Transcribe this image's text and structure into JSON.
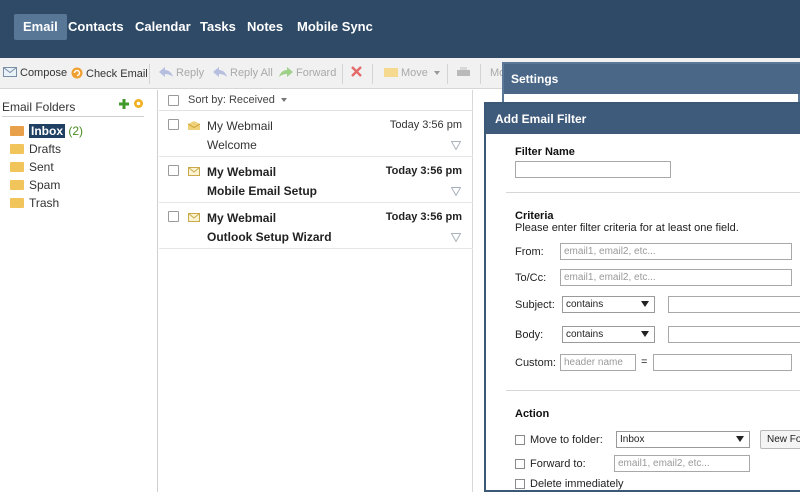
{
  "nav": {
    "items": [
      "Email",
      "Contacts",
      "Calendar",
      "Tasks",
      "Notes",
      "Mobile Sync"
    ],
    "active": "Email"
  },
  "toolbar": {
    "compose": "Compose",
    "check_email": "Check Email",
    "reply": "Reply",
    "reply_all": "Reply All",
    "forward": "Forward",
    "move": "Move",
    "more": "Mo"
  },
  "folders": {
    "title": "Email Folders",
    "items": [
      {
        "name": "Inbox",
        "count": "(2)",
        "selected": true
      },
      {
        "name": "Drafts"
      },
      {
        "name": "Sent"
      },
      {
        "name": "Spam"
      },
      {
        "name": "Trash"
      }
    ]
  },
  "list": {
    "sort_label": "Sort by: Received",
    "messages": [
      {
        "sender": "My Webmail",
        "subject": "Welcome",
        "date": "Today 3:56 pm",
        "unread": false
      },
      {
        "sender": "My Webmail",
        "subject": "Mobile Email Setup",
        "date": "Today 3:56 pm",
        "unread": true
      },
      {
        "sender": "My Webmail",
        "subject": "Outlook Setup Wizard",
        "date": "Today 3:56 pm",
        "unread": true
      }
    ]
  },
  "settings": {
    "title": "Settings"
  },
  "filter": {
    "title": "Add Email Filter",
    "filter_name_label": "Filter Name",
    "filter_name_value": "",
    "criteria_heading": "Criteria",
    "criteria_note": "Please enter filter criteria for at least one field.",
    "from_label": "From:",
    "from_placeholder": "email1, email2, etc...",
    "tocc_label": "To/Cc:",
    "tocc_placeholder": "email1, email2, etc...",
    "subject_label": "Subject:",
    "subject_op": "contains",
    "body_label": "Body:",
    "body_op": "contains",
    "custom_label": "Custom:",
    "custom_placeholder": "header name",
    "custom_eq": "=",
    "action_heading": "Action",
    "move_label": "Move to folder:",
    "move_folder": "Inbox",
    "new_folder_button": "New Fo",
    "forward_label": "Forward to:",
    "forward_placeholder": "email1, email2, etc...",
    "delete_label": "Delete immediately"
  },
  "colors": {
    "nav_bg": "#2e4a66",
    "nav_active": "#587796",
    "selection": "#1f3f63",
    "count_green": "#4b8a22",
    "folder_yellow": "#f2c55c"
  }
}
